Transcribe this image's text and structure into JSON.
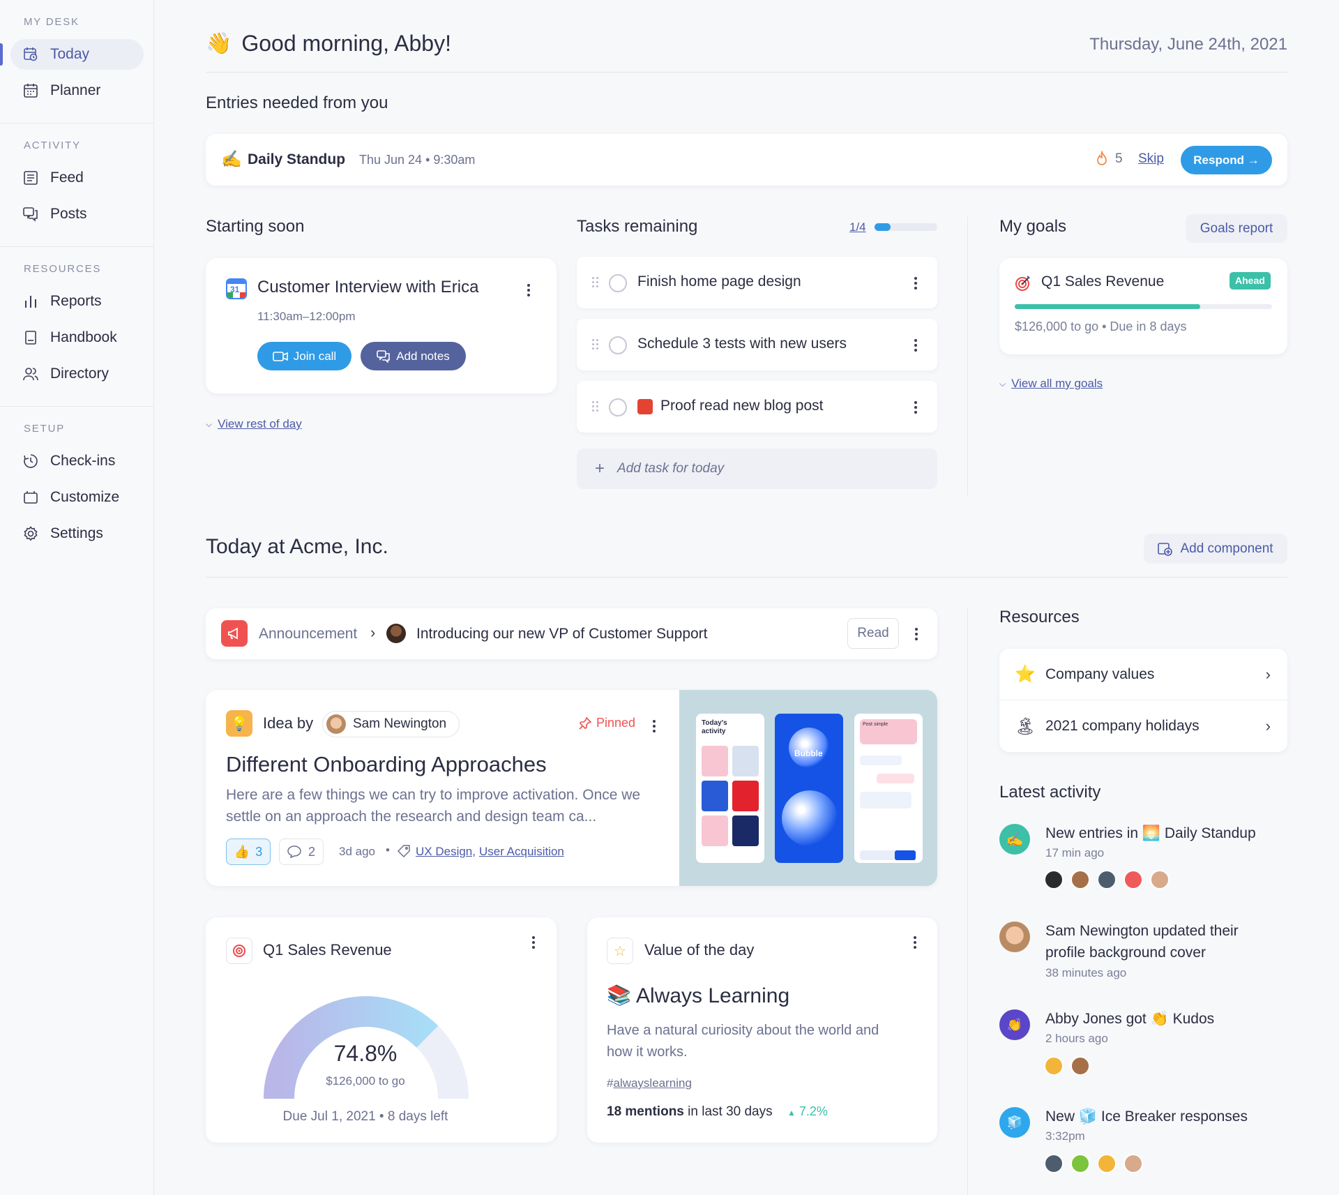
{
  "sidebar": {
    "sections": [
      {
        "title": "MY DESK",
        "items": [
          {
            "label": "Today",
            "icon": "today-icon",
            "active": true
          },
          {
            "label": "Planner",
            "icon": "calendar-icon"
          }
        ]
      },
      {
        "title": "ACTIVITY",
        "items": [
          {
            "label": "Feed",
            "icon": "feed-icon"
          },
          {
            "label": "Posts",
            "icon": "posts-icon"
          }
        ]
      },
      {
        "title": "RESOURCES",
        "items": [
          {
            "label": "Reports",
            "icon": "bar-chart-icon"
          },
          {
            "label": "Handbook",
            "icon": "book-icon"
          },
          {
            "label": "Directory",
            "icon": "people-icon"
          }
        ]
      },
      {
        "title": "SETUP",
        "items": [
          {
            "label": "Check-ins",
            "icon": "clock-icon"
          },
          {
            "label": "Customize",
            "icon": "folder-icon"
          },
          {
            "label": "Settings",
            "icon": "gear-icon"
          }
        ]
      }
    ]
  },
  "header": {
    "greeting_emoji": "👋",
    "greeting": "Good morning, Abby!",
    "date": "Thursday, June 24th, 2021"
  },
  "entries": {
    "heading": "Entries needed from you",
    "emoji": "✍️",
    "title": "Daily Standup",
    "when": "Thu Jun 24 • 9:30am",
    "streak": "5",
    "skip": "Skip",
    "respond": "Respond →"
  },
  "starting_soon": {
    "heading": "Starting soon",
    "event_title": "Customer Interview with Erica",
    "calendar_day": "31",
    "time": "11:30am–12:00pm",
    "join_call": "Join call",
    "add_notes": "Add notes",
    "view_rest": "View rest of day"
  },
  "tasks": {
    "heading": "Tasks remaining",
    "progress_label": "1/4",
    "progress": 0.25,
    "items": [
      {
        "text": "Finish home page design"
      },
      {
        "text": "Schedule 3 tests with new users"
      },
      {
        "text": "Proof read new blog post"
      }
    ],
    "add_placeholder": "Add task for today"
  },
  "goals": {
    "heading": "My goals",
    "report": "Goals report",
    "goal_title": "Q1 Sales Revenue",
    "badge": "Ahead",
    "progress": 0.72,
    "sub": "$126,000 to go • Due in 8 days",
    "view_all": "View all my goals"
  },
  "company": {
    "heading": "Today at Acme, Inc.",
    "add_component": "Add component"
  },
  "announcement": {
    "category": "Announcement",
    "chevron": "›",
    "title": "Introducing our new VP of Customer Support",
    "read": "Read"
  },
  "idea": {
    "prefix": "Idea by",
    "author": "Sam Newington",
    "pinned": "Pinned",
    "title": "Different Onboarding Approaches",
    "body": "Here are a few things we can try to improve activation. Once we settle on an approach the research and design team ca...",
    "likes": "3",
    "comments": "2",
    "age": "3d ago",
    "tags": [
      "UX Design,",
      "User Acquisition"
    ],
    "mock_screen1_title": "Today's activity",
    "mock_screen2_title": "Bubble",
    "mock_screen3_title": "Post simple"
  },
  "sales_widget": {
    "title": "Q1 Sales Revenue",
    "percent": "74.8%",
    "percent_value": 74.8,
    "sub": "$126,000 to go",
    "due": "Due Jul 1, 2021 • 8 days left"
  },
  "value_widget": {
    "title": "Value of the day",
    "emoji": "📚",
    "value": "Always Learning",
    "desc": "Have a natural curiosity about the world and how it works.",
    "hashtag_prefix": "#",
    "hashtag": "alwayslearning",
    "mentions_bold": "18 mentions",
    "mentions_rest": " in last 30 days",
    "trend": "7.2%"
  },
  "resources": {
    "heading": "Resources",
    "items": [
      {
        "emoji": "⭐",
        "label": "Company values"
      },
      {
        "emoji": "🏝",
        "label": "2021 company holidays"
      }
    ]
  },
  "activity": {
    "heading": "Latest activity",
    "items": [
      {
        "pre": "New entries in ",
        "emoji": "🌅",
        "bold": "Daily Standup",
        "post": "",
        "time": "17 min ago"
      },
      {
        "pre": "Sam Newington updated their profile background cover",
        "emoji": "",
        "bold": "",
        "post": "",
        "time": "38 minutes ago"
      },
      {
        "pre": "Abby Jones got ",
        "emoji": "👏",
        "bold": "Kudos",
        "post": "",
        "time": "2 hours ago"
      },
      {
        "pre": "New ",
        "emoji": "🧊",
        "bold": "Ice Breaker",
        "post": " responses",
        "time": "3:32pm"
      }
    ]
  },
  "colors": {
    "accent": "#2f9be6",
    "primary": "#4b5aa6",
    "teal": "#3cc0a8",
    "red": "#f05252"
  }
}
